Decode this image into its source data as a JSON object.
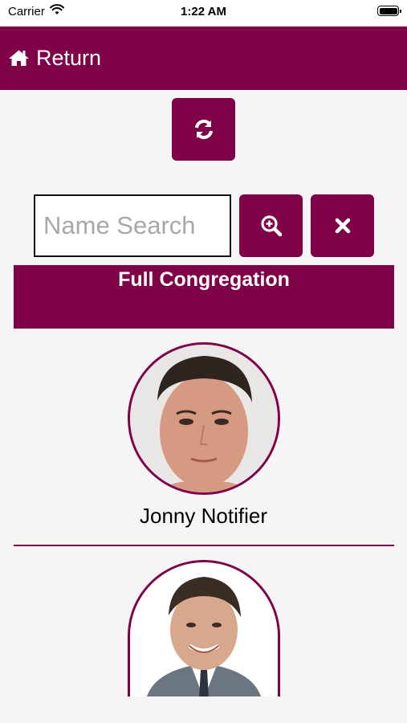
{
  "status_bar": {
    "carrier": "Carrier",
    "time": "1:22 AM"
  },
  "nav": {
    "return_label": "Return"
  },
  "search": {
    "placeholder": "Name Search",
    "value": ""
  },
  "filter": {
    "label": "Full Congregation"
  },
  "members": [
    {
      "name": "Jonny Notifier"
    },
    {
      "name": ""
    }
  ],
  "icons": {
    "home": "home-icon",
    "refresh": "refresh-icon",
    "search": "zoom-in-icon",
    "clear": "close-icon"
  },
  "colors": {
    "accent": "#7f0249",
    "background": "#f5f5f5"
  }
}
